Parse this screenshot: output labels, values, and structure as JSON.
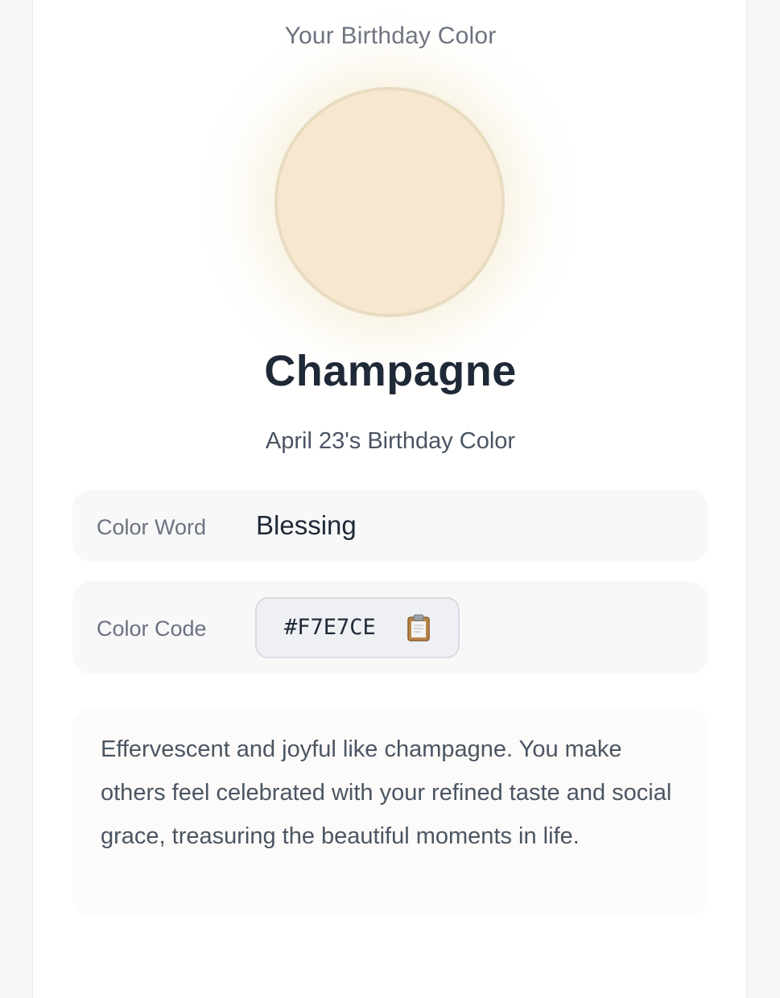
{
  "header": {
    "eyebrow": "Your Birthday Color"
  },
  "color": {
    "name": "Champagne",
    "subtitle": "April 23's Birthday Color",
    "swatch_hex": "#F7E7CE"
  },
  "details": {
    "word_label": "Color Word",
    "word_value": "Blessing",
    "code_label": "Color Code",
    "code_value": "#F7E7CE",
    "copy_icon": "clipboard-icon"
  },
  "description": "Effervescent and joyful like champagne. You make others feel celebrated with your refined taste and social grace, treasuring the beautiful moments in life.",
  "colors": {
    "card_background": "#FFFFFF",
    "page_background": "#F7F7F8",
    "title_text": "#1F2937",
    "muted_text": "#6B7280"
  }
}
